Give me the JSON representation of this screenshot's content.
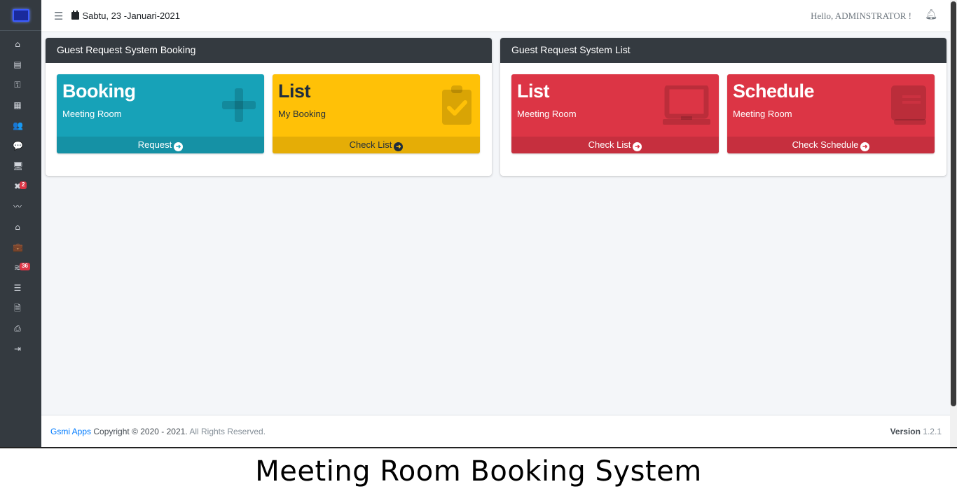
{
  "topbar": {
    "date": "Sabtu, 23 -Januari-2021",
    "greeting": "Hello, ADMINSTRATOR !"
  },
  "sidebar": {
    "items": [
      {
        "icon": "home-icon",
        "glyph": "⌂"
      },
      {
        "icon": "list-icon",
        "glyph": "▤"
      },
      {
        "icon": "key-icon",
        "glyph": "⚿"
      },
      {
        "icon": "grid-icon",
        "glyph": "▦"
      },
      {
        "icon": "users-icon",
        "glyph": "👥"
      },
      {
        "icon": "comments-icon",
        "glyph": "💬"
      },
      {
        "icon": "desktop-icon",
        "glyph": "🖥"
      },
      {
        "icon": "tools-icon",
        "glyph": "✖",
        "badge": "2"
      },
      {
        "icon": "signature-icon",
        "glyph": "〰"
      },
      {
        "icon": "warehouse-icon",
        "glyph": "⌂"
      },
      {
        "icon": "briefcase-icon",
        "glyph": "💼"
      },
      {
        "icon": "database-icon",
        "glyph": "≋",
        "badge": "36"
      },
      {
        "icon": "tasks-icon",
        "glyph": "☰"
      },
      {
        "icon": "file-icon",
        "glyph": "🗎"
      },
      {
        "icon": "print-icon",
        "glyph": "⎙"
      },
      {
        "icon": "sign-out-icon",
        "glyph": "⇥"
      }
    ]
  },
  "booking_card": {
    "title": "Guest Request System Booking",
    "boxes": [
      {
        "title": "Booking",
        "subtitle": "Meeting Room",
        "link": "Request",
        "color": "#17a2b8",
        "icon": "plus-icon"
      },
      {
        "title": "List",
        "subtitle": "My Booking",
        "link": "Check List",
        "color": "#ffc107",
        "icon": "clipboard-check-icon"
      }
    ]
  },
  "list_card": {
    "title": "Guest Request System List",
    "boxes": [
      {
        "title": "List",
        "subtitle": "Meeting Room",
        "link": "Check List",
        "color": "#dc3545",
        "icon": "laptop-icon"
      },
      {
        "title": "Schedule",
        "subtitle": "Meeting Room",
        "link": "Check Schedule",
        "color": "#dc3545",
        "icon": "book-icon"
      }
    ]
  },
  "footer": {
    "brand": "Gsmi Apps",
    "copyright": "Copyright © 2020 - 2021.",
    "rights": "All Rights Reserved.",
    "version_label": "Version",
    "version": "1.2.1"
  },
  "caption": "Meeting Room Booking System"
}
